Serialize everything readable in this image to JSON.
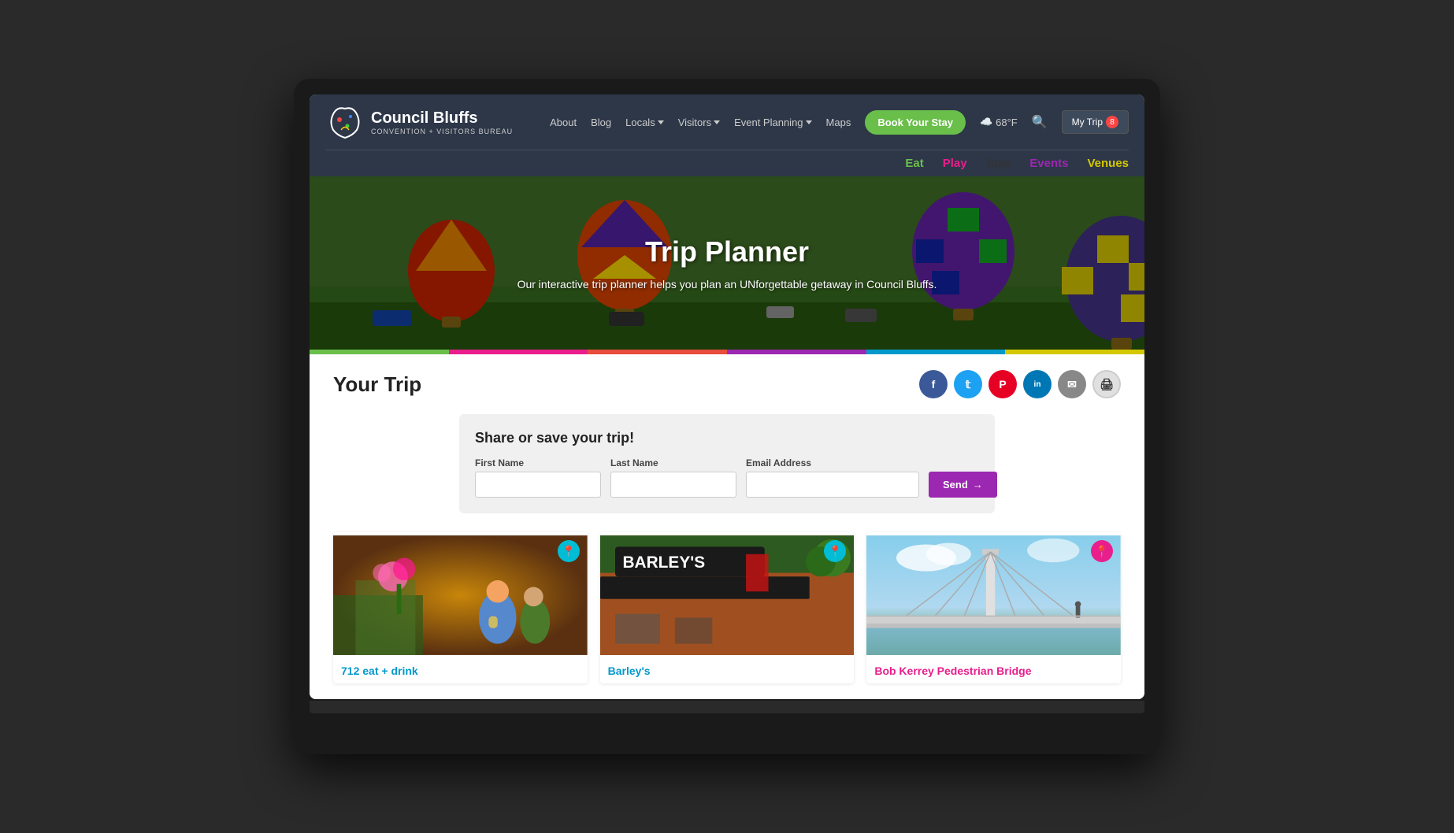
{
  "header": {
    "logo": {
      "main_name": "Council Bluffs",
      "sub_name": "Convention + Visitors Bureau"
    },
    "nav": {
      "about": "About",
      "blog": "Blog",
      "locals": "Locals",
      "visitors": "Visitors",
      "event_planning": "Event Planning",
      "maps": "Maps",
      "book_stay": "Book Your Stay",
      "weather": "68°F",
      "my_trip": "My Trip",
      "trip_count": "8"
    },
    "sub_nav": {
      "eat": "Eat",
      "play": "Play",
      "stay": "Stay",
      "events": "Events",
      "venues": "Venues"
    }
  },
  "hero": {
    "title": "Trip Planner",
    "subtitle": "Our interactive trip planner helps you plan an UNforgettable getaway in Council Bluffs."
  },
  "color_bar": [
    "#6abf4b",
    "#e91e8c",
    "#e74c3c",
    "#9c27b0",
    "#0099cc",
    "#d4c800"
  ],
  "main": {
    "your_trip_title": "Your Trip",
    "share_form": {
      "title": "Share or save your trip!",
      "first_name_label": "First Name",
      "last_name_label": "Last Name",
      "email_label": "Email Address",
      "send_label": "Send"
    },
    "social": {
      "facebook": "f",
      "twitter": "t",
      "pinterest": "p",
      "linkedin": "in",
      "email": "✉",
      "print": "🖨"
    },
    "cards": [
      {
        "title": "712 eat + drink",
        "color": "blue",
        "pin_color": "cyan"
      },
      {
        "title": "Barley's",
        "color": "blue",
        "pin_color": "cyan"
      },
      {
        "title": "Bob Kerrey Pedestrian Bridge",
        "color": "red",
        "pin_color": "red"
      }
    ]
  }
}
